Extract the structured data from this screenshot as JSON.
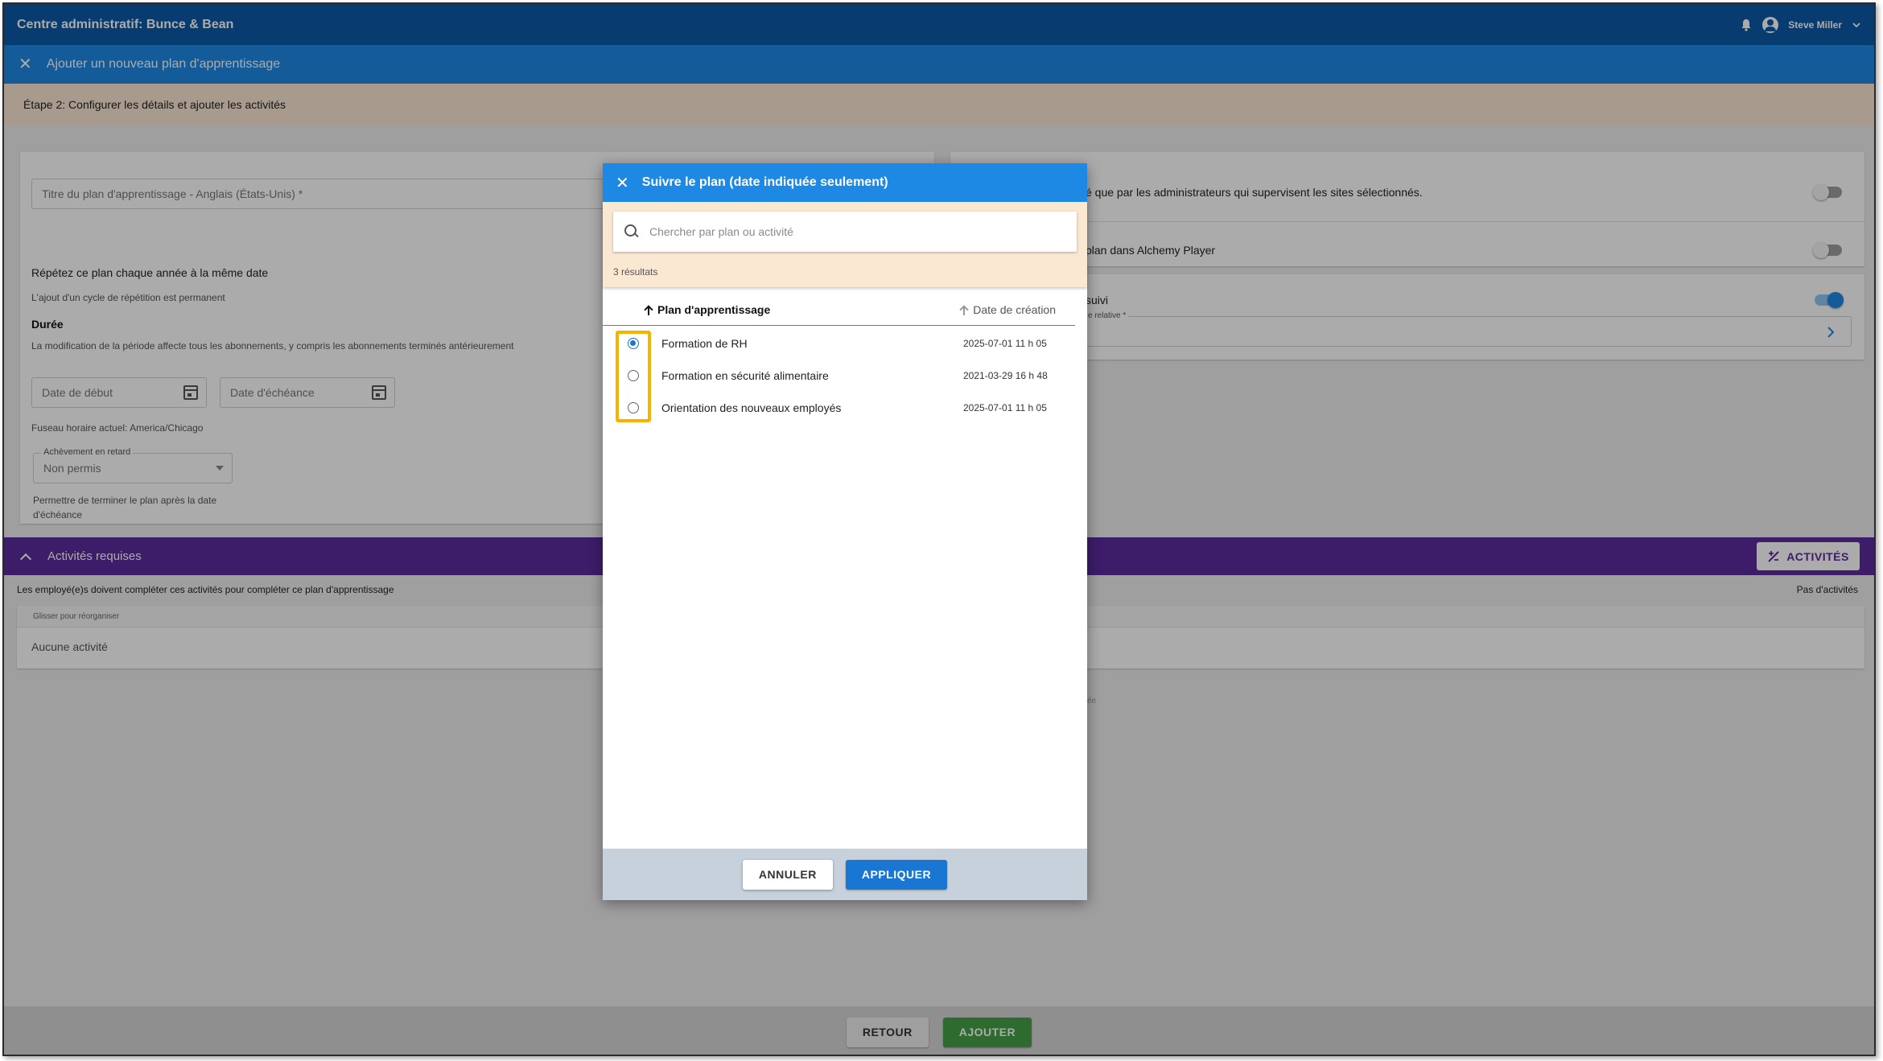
{
  "app": {
    "title": "Centre administratif: Bunce & Bean",
    "user_name": "Steve Miller"
  },
  "subheader": {
    "title": "Ajouter un nouveau plan d'apprentissage"
  },
  "step": {
    "label": "Étape 2: Configurer les détails et ajouter les activités"
  },
  "form": {
    "title_placeholder": "Titre du plan d'apprentissage - Anglais (États-Unis) *",
    "repeat_label": "Répétez ce plan chaque année à la même date",
    "repeat_help": "L'ajout d'un cycle de répétition est permanent",
    "duration_label": "Durée",
    "duration_help": "La modification de la période affecte tous les abonnements, y compris les abonnements terminés antérieurement",
    "start_date_placeholder": "Date de début",
    "due_date_placeholder": "Date d'échéance",
    "timezone": "Fuseau horaire actuel: America/Chicago",
    "late_label": "Achèvement en retard",
    "late_value": "Non permis",
    "late_help": "Permettre de terminer le plan après la date d'échéance"
  },
  "right_panel": {
    "visibility_text": "é que par les administrateurs qui supervisent les sites sélectionnés.",
    "player_text": "plan dans Alchemy Player",
    "follow_text": "suivi",
    "relative_label": "e relative *",
    "stray_text": "ée"
  },
  "activities": {
    "header": "Activités requises",
    "button": "ACTIVITÉS",
    "description": "Les employé(e)s doivent compléter ces activités pour compléter ce plan d'apprentissage",
    "count_text": "Pas d'activités",
    "drag_hint": "Glisser pour réorganiser",
    "empty": "Aucune activité"
  },
  "footer": {
    "back": "RETOUR",
    "add": "AJOUTER"
  },
  "dialog": {
    "title": "Suivre le plan (date indiquée seulement)",
    "search_placeholder": "Chercher par plan ou activité",
    "results": "3 résultats",
    "columns": {
      "plan": "Plan d'apprentissage",
      "created": "Date de création"
    },
    "rows": [
      {
        "name": "Formation de RH",
        "date": "2025-07-01 11 h 05",
        "selected": true
      },
      {
        "name": "Formation en sécurité alimentaire",
        "date": "2021-03-29 16 h 48",
        "selected": false
      },
      {
        "name": "Orientation des nouveaux employés",
        "date": "2025-07-01 11 h 05",
        "selected": false
      }
    ],
    "cancel": "ANNULER",
    "apply": "APPLIQUER"
  },
  "colors": {
    "appbar": "#0d5aa7",
    "primary": "#1e88e5",
    "activities_bar": "#5b2a9e",
    "highlight": "#f4b400",
    "add_button": "#43a047"
  }
}
